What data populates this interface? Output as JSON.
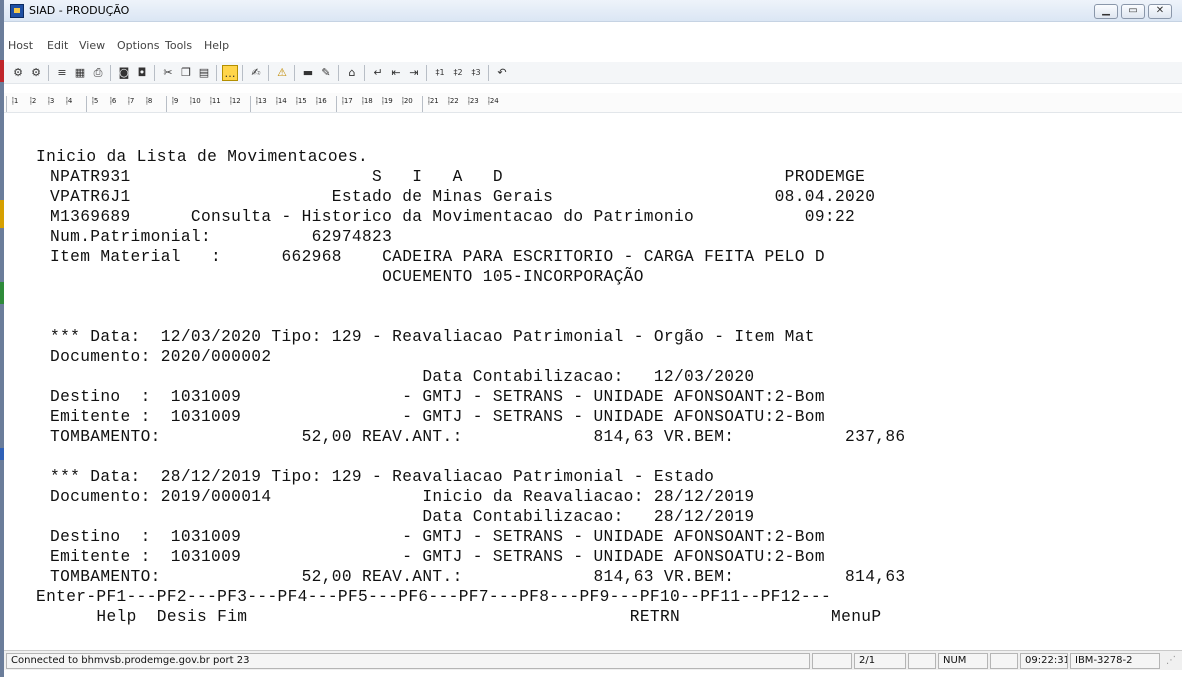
{
  "window": {
    "title": "SIAD - PRODUÇÃO"
  },
  "menu": [
    "Host",
    "Edit",
    "View",
    "Options",
    "Tools",
    "Help"
  ],
  "pf_keys": [
    "1",
    "2",
    "3",
    "4",
    "5",
    "6",
    "7",
    "8",
    "9",
    "10",
    "11",
    "12",
    "13",
    "14",
    "15",
    "16",
    "17",
    "18",
    "19",
    "20",
    "21",
    "22",
    "23",
    "24"
  ],
  "terminal": {
    "lines": [
      "Inicio da Lista de Movimentacoes.",
      "NPATR931                        S   I   A   D                            PRODEMGE",
      "VPATR6J1                    Estado de Minas Gerais                      08.04.2020",
      "M1369689      Consulta - Historico da Movimentacao do Patrimonio           09:22",
      "Num.Patrimonial:          62974823",
      "Item Material   :      662968    CADEIRA PARA ESCRITORIO - CARGA FEITA PELO D",
      "                                 OCUEMENTO 105-INCORPORAÇÃO",
      "",
      "",
      "*** Data:  12/03/2020 Tipo: 129 - Reavaliacao Patrimonial - Orgão - Item Mat",
      "Documento: 2020/000002",
      "                                     Data Contabilizacao:   12/03/2020",
      "Destino  :  1031009                - GMTJ - SETRANS - UNIDADE AFONSOANT:2-Bom",
      "Emitente :  1031009                - GMTJ - SETRANS - UNIDADE AFONSOATU:2-Bom",
      "TOMBAMENTO:              52,00 REAV.ANT.:             814,63 VR.BEM:           237,86",
      "",
      "*** Data:  28/12/2019 Tipo: 129 - Reavaliacao Patrimonial - Estado",
      "Documento: 2019/000014               Inicio da Reavaliacao: 28/12/2019",
      "                                     Data Contabilizacao:   28/12/2019",
      "Destino  :  1031009                - GMTJ - SETRANS - UNIDADE AFONSOANT:2-Bom",
      "Emitente :  1031009                - GMTJ - SETRANS - UNIDADE AFONSOATU:2-Bom",
      "TOMBAMENTO:              52,00 REAV.ANT.:             814,63 VR.BEM:           814,63",
      "Enter-PF1---PF2---PF3---PF4---PF5---PF6---PF7---PF8---PF9---PF10--PF11--PF12---",
      "      Help  Desis Fim                                      RETRN               MenuP"
    ]
  },
  "status": {
    "connection": "Connected to bhmvsb.prodemge.gov.br port 23",
    "page": "2/1",
    "num": "NUM",
    "time": "09:22:31",
    "terminal_type": "IBM-3278-2"
  }
}
